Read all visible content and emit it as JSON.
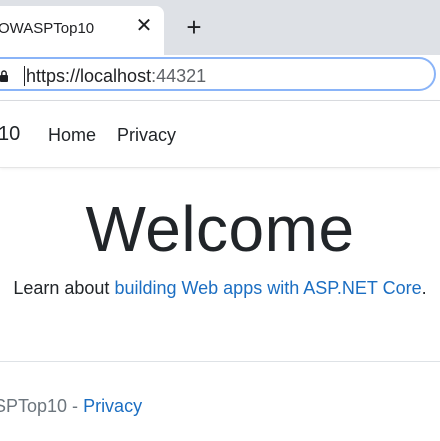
{
  "browser": {
    "tab_title": "OWASPTop10",
    "close_glyph": "✕",
    "new_tab_glyph": "+",
    "url_scheme_host": "https://localhost",
    "url_port": ":44321"
  },
  "navbar": {
    "brand": "10",
    "links": [
      "Home",
      "Privacy"
    ]
  },
  "main": {
    "heading": "Welcome",
    "learn_prefix": "Learn about ",
    "learn_link": "building Web apps with ASP.NET Core",
    "learn_suffix": "."
  },
  "footer": {
    "text": "SPTop10 - ",
    "link": "Privacy"
  },
  "colors": {
    "link": "#1b6ec2",
    "tabstrip": "#dee1e6",
    "omnibox_focus": "#8ab4f8"
  },
  "icons": [
    "lock-icon",
    "close-icon",
    "plus-icon"
  ]
}
